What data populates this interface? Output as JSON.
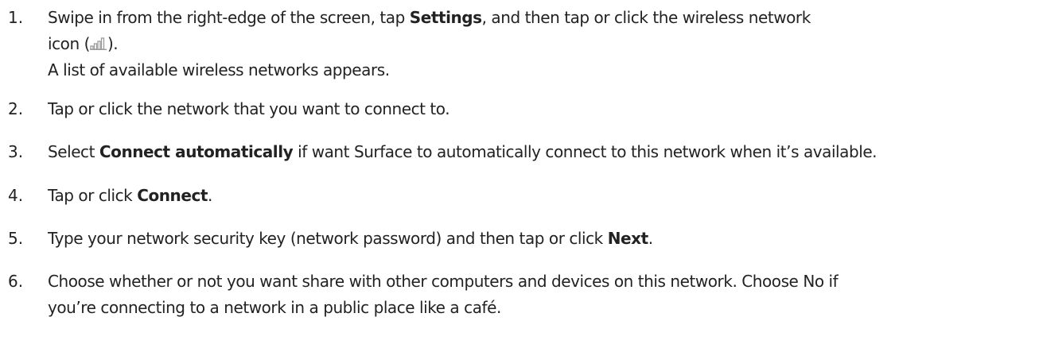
{
  "steps": [
    {
      "number": "1.",
      "line1_a": "Swipe in from the right-edge of the screen, tap ",
      "line1_b": "Settings",
      "line1_c": ", and then tap or click the wireless network",
      "line2_a": "icon (",
      "icon": "wireless-signal-icon",
      "line2_b": ").",
      "line3": "A list of available wireless networks appears."
    },
    {
      "number": "2.",
      "text": "Tap or click the network that you want to connect to."
    },
    {
      "number": "3.",
      "text_a": "Select ",
      "bold": "Connect automatically",
      "text_b": " if want Surface to automatically connect to this network when it’s available."
    },
    {
      "number": "4.",
      "text_a": "Tap or click ",
      "bold": "Connect",
      "text_b": "."
    },
    {
      "number": "5.",
      "text_a": "Type your network security key (network password) and then tap or click ",
      "bold": "Next",
      "text_b": "."
    },
    {
      "number": "6.",
      "line1": "Choose whether or not you want share with other computers and devices on this network. Choose No if",
      "line2": "you’re connecting to a network in a public place like a café."
    }
  ],
  "colors": {
    "text": "#222222",
    "icon": "#9a9a9a"
  }
}
